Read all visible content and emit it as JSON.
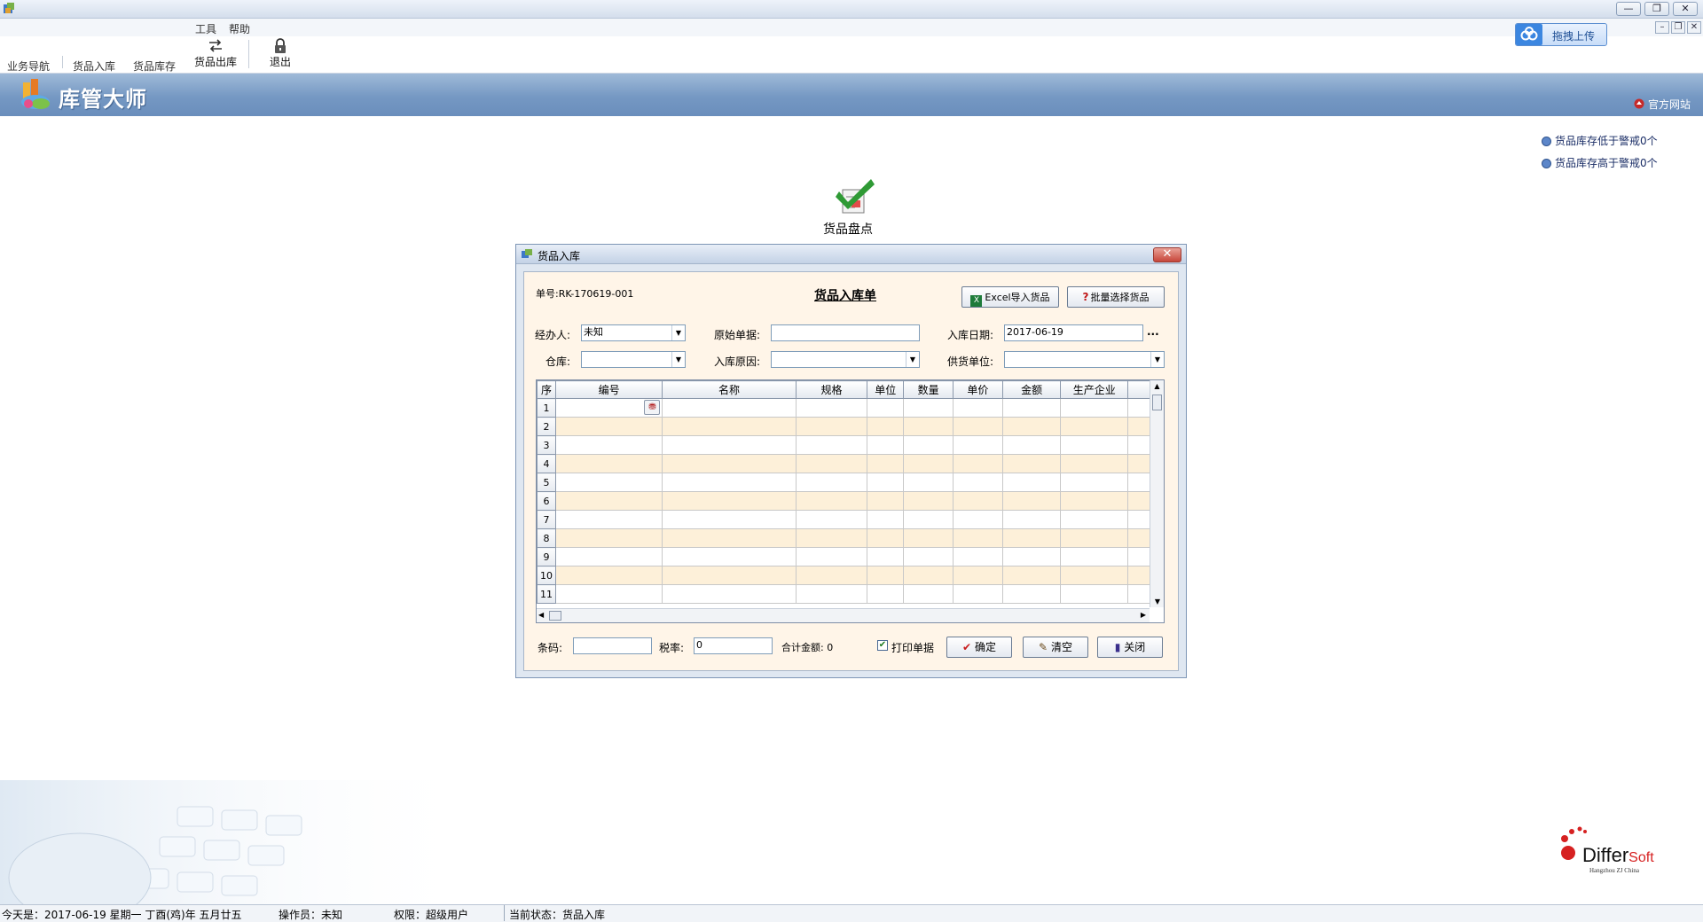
{
  "window": {
    "min_label": "—",
    "max_label": "❐",
    "close_label": "✕"
  },
  "menu": {
    "items": [
      "工具",
      "帮助"
    ]
  },
  "toolbar": {
    "clipped_labels": [
      "业务导航",
      "货品入库",
      "货品库存"
    ],
    "stock_out_label": "货品出库",
    "exit_label": "退出"
  },
  "upload": {
    "label": "拖拽上传"
  },
  "brand": {
    "name": "库管大师",
    "site_link": "官方网站"
  },
  "warnings": [
    "货品库存低于警戒0个",
    "货品库存高于警戒0个"
  ],
  "desktop": {
    "inventory_check_label": "货品盘点"
  },
  "dialog": {
    "title": "货品入库",
    "close_label": "✕",
    "order_no_label": "单号:",
    "order_no": "RK-170619-001",
    "form_title": "货品入库单",
    "excel_import_label": "Excel导入货品",
    "batch_select_label": "批量选择货品",
    "handler_label": "经办人:",
    "handler_value": "未知",
    "original_doc_label": "原始单据:",
    "original_doc_value": "",
    "date_label": "入库日期:",
    "date_value": "2017-06-19",
    "date_more": "...",
    "warehouse_label": "仓库:",
    "warehouse_value": "",
    "reason_label": "入库原因:",
    "reason_value": "",
    "supplier_label": "供货单位:",
    "supplier_value": "",
    "barcode_label": "条码:",
    "barcode_value": "",
    "tax_label": "税率:",
    "tax_value": "0",
    "total_label": "合计金额:",
    "total_value": "0",
    "print_label": "打印单据",
    "print_checked": true,
    "confirm_label": "确定",
    "clear_label": "清空",
    "close_button_label": "关闭"
  },
  "grid": {
    "columns": [
      "序",
      "编号",
      "名称",
      "规格",
      "单位",
      "数量",
      "单价",
      "金额",
      "生产企业"
    ],
    "rows": [
      "1",
      "2",
      "3",
      "4",
      "5",
      "6",
      "7",
      "8",
      "9",
      "10",
      "11"
    ]
  },
  "status": {
    "today": "今天是：2017-06-19 星期一 丁酉(鸡)年 五月廿五",
    "operator": "操作员：未知",
    "permission": "权限：超级用户",
    "state": "当前状态：货品入库"
  },
  "logo": {
    "name_prefix": "Differ",
    "name_suffix": "Soft",
    "tagline": "Hangzhou ZJ China"
  },
  "colors": {
    "banner": "#7598c3",
    "accent_red": "#d62121",
    "grid_alt_row": "#fdf0d9"
  }
}
